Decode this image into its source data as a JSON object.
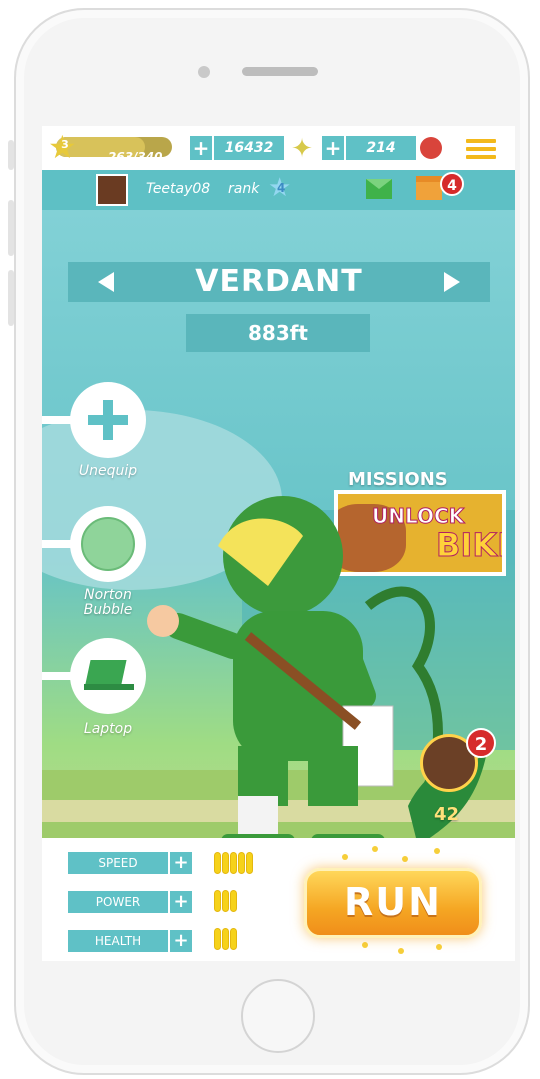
{
  "status_bar": {
    "level": "3",
    "xp": "263/340",
    "xp_fraction": 0.77,
    "shuriken_count": "16432",
    "ball_count": "214",
    "plus_label": "+"
  },
  "profile": {
    "username": "Teetay08",
    "rank_label": "rank",
    "rank_value": "4",
    "gift_badge": "4"
  },
  "level": {
    "name": "VERDANT",
    "distance": "883ft"
  },
  "equipment": {
    "slots": [
      {
        "label": "Unequip"
      },
      {
        "label": "Norton Bubble"
      },
      {
        "label": "Laptop"
      }
    ]
  },
  "missions": {
    "title": "MISSIONS",
    "card_line1": "UNLOCK",
    "card_line2": "BIKI"
  },
  "pickup": {
    "badge": "2",
    "count": "42"
  },
  "stats": [
    {
      "label": "SPEED",
      "level": 5
    },
    {
      "label": "POWER",
      "level": 3
    },
    {
      "label": "HEALTH",
      "level": 3
    }
  ],
  "run_button": "RUN",
  "colors": {
    "teal": "#5fc1c6",
    "gold": "#f6d21a",
    "badge_red": "#d62b2b",
    "run_orange": "#f5a623"
  }
}
